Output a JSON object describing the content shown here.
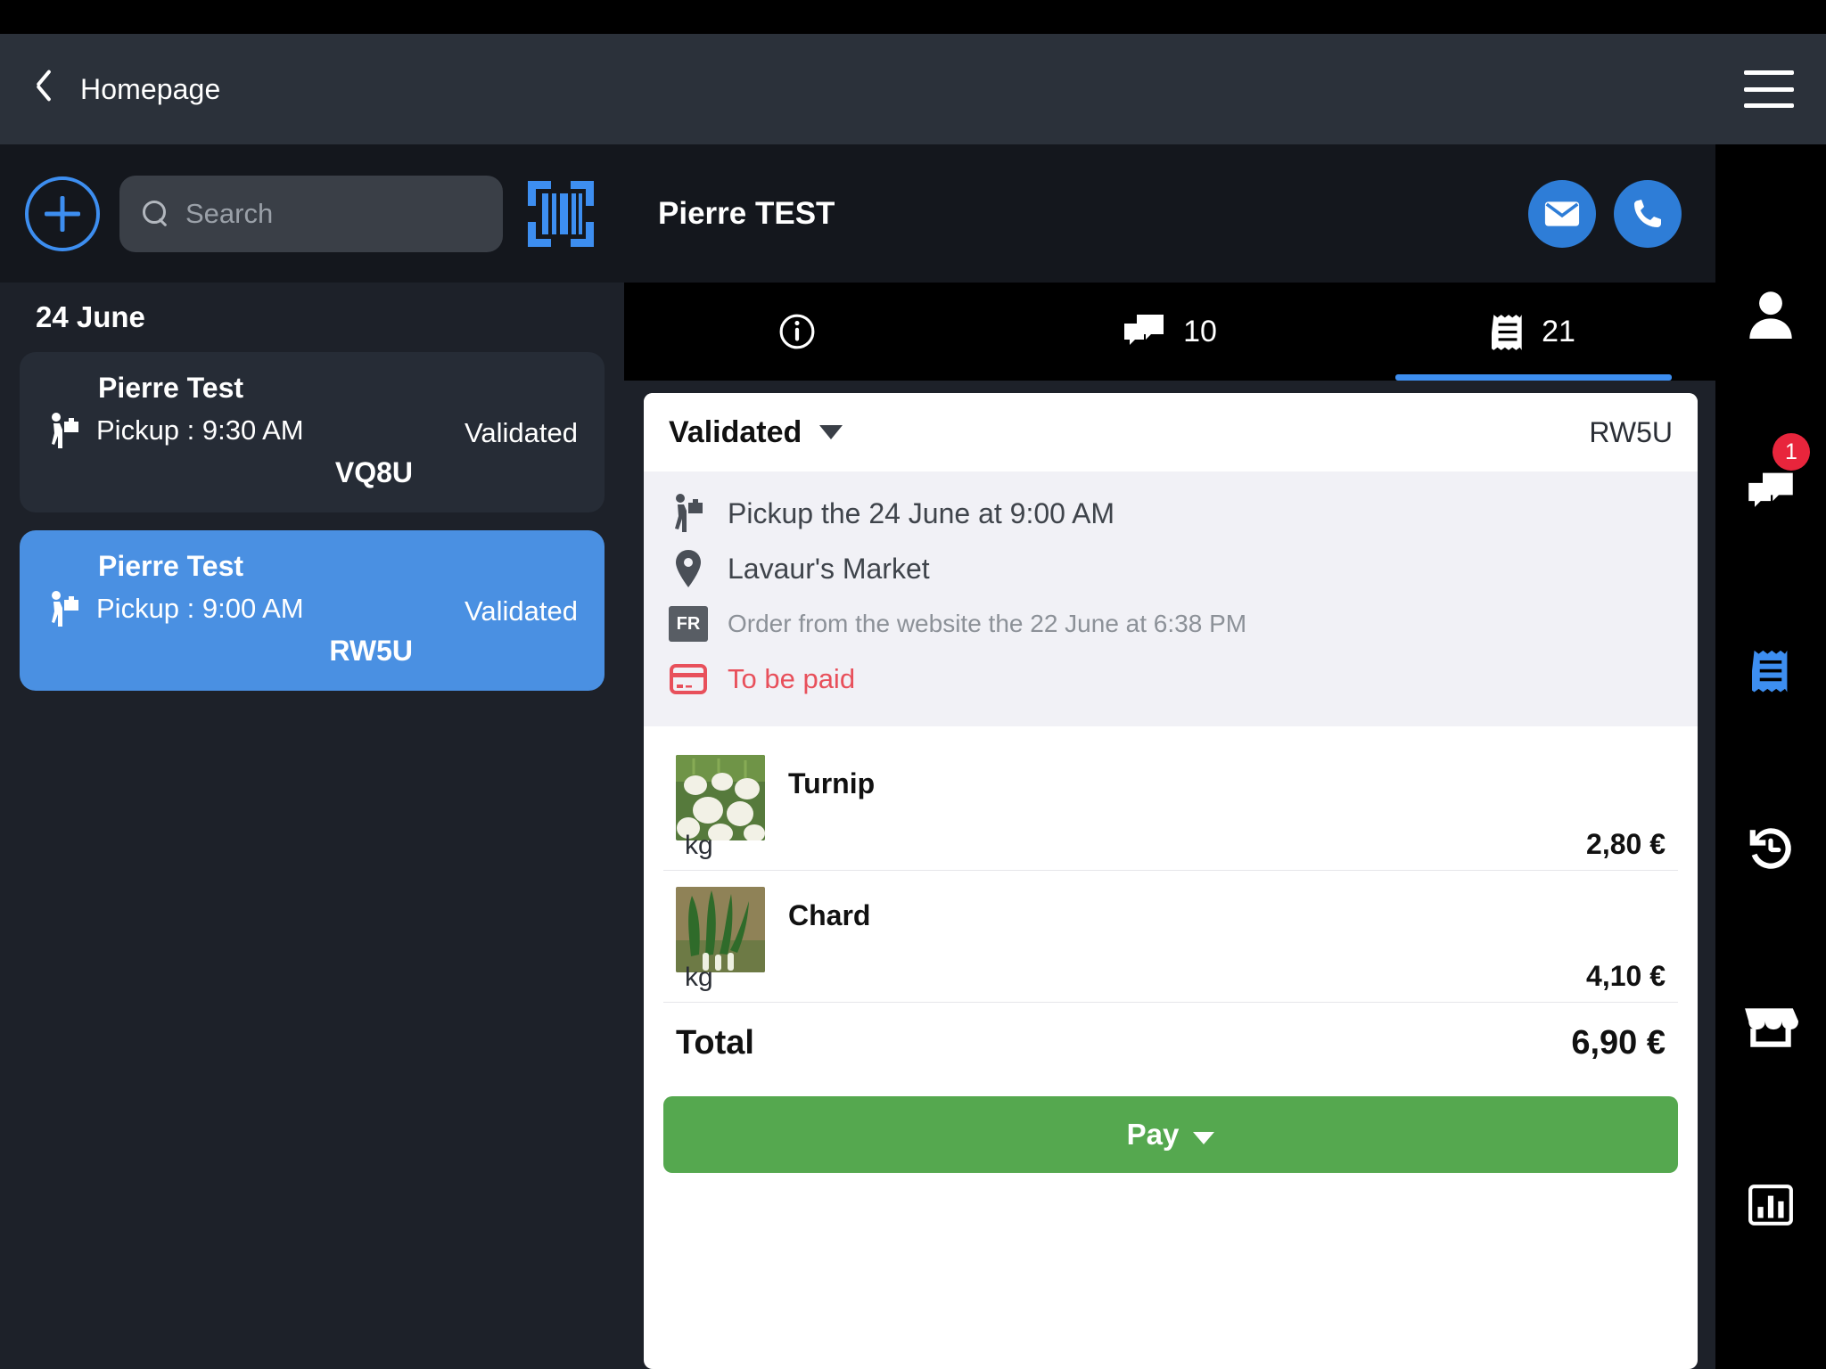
{
  "topbar": {
    "back_label": "Homepage",
    "back_icon": "chevron-left-icon",
    "menu_icon": "hamburger-menu-icon"
  },
  "left_panel": {
    "add_button_icon": "plus-circle-icon",
    "search": {
      "placeholder": "Search",
      "value": "",
      "icon": "search-icon"
    },
    "barcode_icon": "barcode-scan-icon",
    "date_header": "24 June",
    "orders": [
      {
        "name": "Pierre Test",
        "pickup_icon": "pickup-person-icon",
        "pickup": "Pickup : 9:30 AM",
        "status": "Validated",
        "code": "VQ8U",
        "selected": false
      },
      {
        "name": "Pierre Test",
        "pickup_icon": "pickup-person-icon",
        "pickup": "Pickup : 9:00 AM",
        "status": "Validated",
        "code": "RW5U",
        "selected": true
      }
    ]
  },
  "customer": {
    "name": "Pierre TEST",
    "email_icon": "envelope-icon",
    "phone_icon": "phone-icon"
  },
  "tabs": [
    {
      "icon": "info-circle-icon",
      "count": "",
      "active": false
    },
    {
      "icon": "chat-bubbles-icon",
      "count": "10",
      "active": false
    },
    {
      "icon": "receipt-icon",
      "count": "21",
      "active": true
    }
  ],
  "order_detail": {
    "status": "Validated",
    "status_caret_icon": "chevron-down-icon",
    "code": "RW5U",
    "pickup_icon": "pickup-person-icon",
    "pickup_line": "Pickup the 24 June at 9:00 AM",
    "location_icon": "map-pin-icon",
    "location": "Lavaur's Market",
    "lang_badge": "FR",
    "source_line": "Order from the website the 22 June at 6:38 PM",
    "payment_icon": "credit-card-icon",
    "payment_status": "To be paid",
    "items": [
      {
        "name": "Turnip",
        "unit": "kg",
        "price": "2,80 €",
        "thumb_icon": "turnip-photo"
      },
      {
        "name": "Chard",
        "unit": "kg",
        "price": "4,10 €",
        "thumb_icon": "chard-photo"
      }
    ],
    "total_label": "Total",
    "total_value": "6,90 €",
    "pay_label": "Pay",
    "pay_caret_icon": "chevron-down-icon"
  },
  "rail": [
    {
      "icon": "person-icon",
      "badge": ""
    },
    {
      "icon": "chat-bubbles-icon",
      "badge": "1"
    },
    {
      "icon": "receipt-icon",
      "badge": "",
      "active": true
    },
    {
      "icon": "history-clock-icon",
      "badge": ""
    },
    {
      "icon": "store-icon",
      "badge": ""
    },
    {
      "icon": "bar-chart-icon",
      "badge": ""
    }
  ],
  "colors": {
    "accent_blue": "#3d8ef0",
    "selected_blue": "#4a90e2",
    "danger_red": "#e8505b",
    "pay_green": "#55a84f",
    "badge_red": "#e8253c"
  }
}
